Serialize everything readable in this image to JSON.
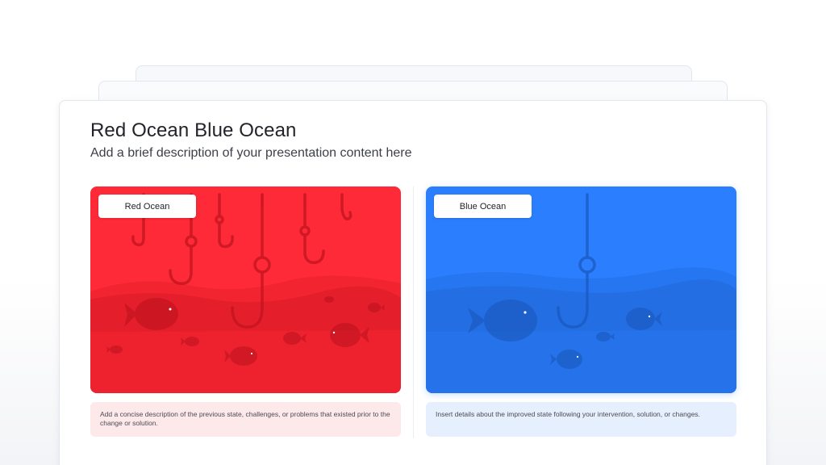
{
  "slide": {
    "title": "Red Ocean Blue Ocean",
    "subtitle": "Add a brief description of your presentation content here"
  },
  "panels": [
    {
      "label": "Red Ocean",
      "description": "Add a concise description of the previous state, challenges, or problems that existed prior to the change or solution.",
      "color": "#ff2a37"
    },
    {
      "label": "Blue Ocean",
      "description": "Insert details about the improved state following your intervention, solution, or changes.",
      "color": "#2b7fff"
    }
  ],
  "icons": [
    "fish-hook-icon",
    "fish-icon",
    "wave-icon"
  ]
}
